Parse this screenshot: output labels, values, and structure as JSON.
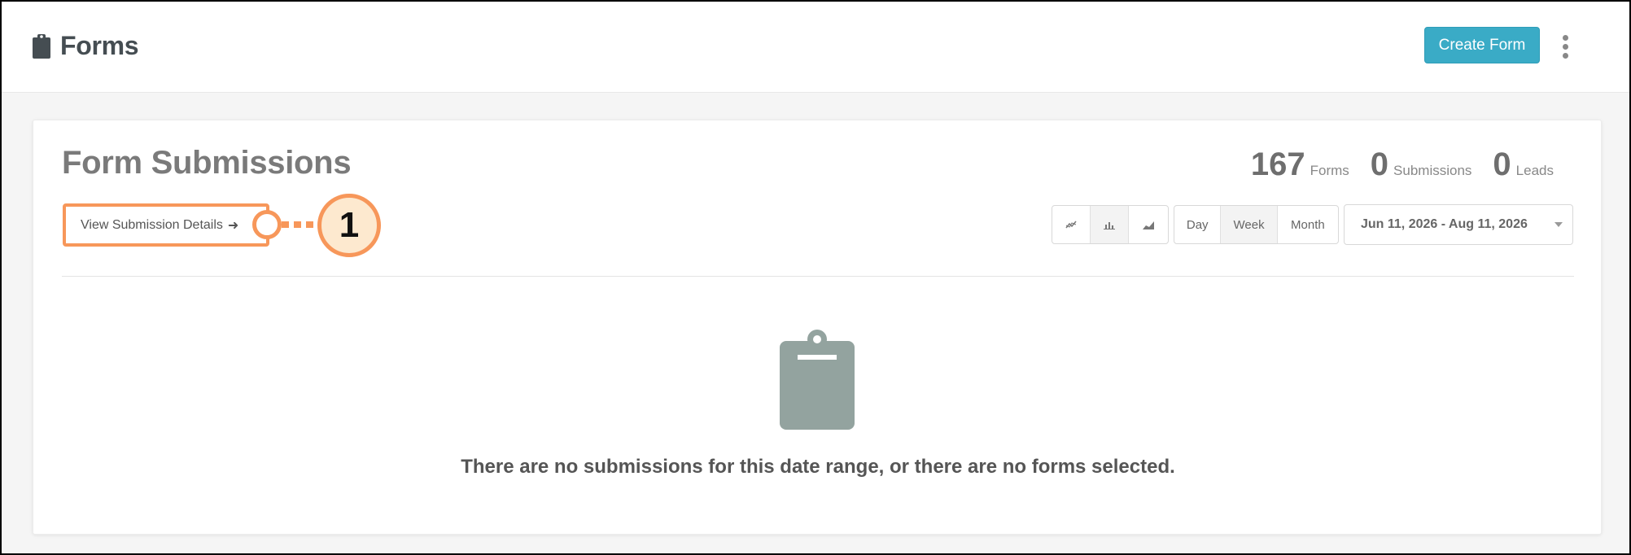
{
  "header": {
    "title": "Forms",
    "title_icon": "clipboard-icon",
    "create_button": "Create Form",
    "more_icon": "kebab-vertical-icon"
  },
  "card": {
    "title": "Form Submissions",
    "view_details_label": "View Submission Details",
    "view_details_arrow": "➜",
    "callout_number": "1",
    "stats": [
      {
        "value": "167",
        "label": "Forms"
      },
      {
        "value": "0",
        "label": "Submissions"
      },
      {
        "value": "0",
        "label": "Leads"
      }
    ],
    "chart_types": [
      {
        "icon": "line-chart-icon",
        "active": false
      },
      {
        "icon": "bar-chart-icon",
        "active": true
      },
      {
        "icon": "area-chart-icon",
        "active": false
      }
    ],
    "periods": [
      {
        "label": "Day",
        "active": false
      },
      {
        "label": "Week",
        "active": true
      },
      {
        "label": "Month",
        "active": false
      }
    ],
    "date_range": "Jun 11, 2026 - Aug 11, 2026",
    "empty_icon": "clipboard-icon",
    "empty_message": "There are no submissions for this date range, or there are no forms selected."
  },
  "colors": {
    "primary": "#3aabc6",
    "callout": "#f7975a",
    "callout_fill": "#fde9cf",
    "empty_icon": "#93a39f"
  }
}
